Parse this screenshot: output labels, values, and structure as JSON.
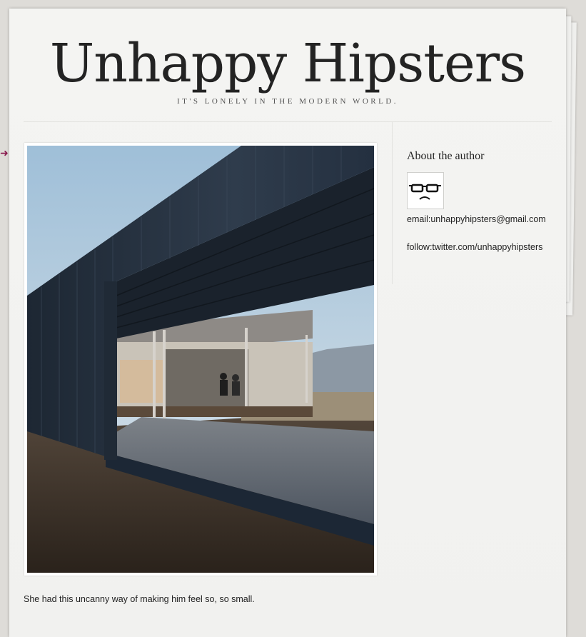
{
  "site": {
    "title": "Unhappy Hipsters",
    "tagline": "It's lonely in the modern world."
  },
  "post": {
    "photo_alt": "Modernist house with dark metal cladding and open terrace, two people seated inside",
    "caption": "She had this uncanny way of making him feel so, so small."
  },
  "sidebar": {
    "heading": "About the author",
    "avatar_icon": "sad-glasses-face-icon",
    "email": "email:unhappyhipsters@gmail.com",
    "twitter": "follow:twitter.com/unhappyhipsters"
  },
  "colors": {
    "background": "#dedcd8",
    "page": "#f2f2f0",
    "title_text": "#232323",
    "nav_arrow": "#8a1b4f"
  }
}
